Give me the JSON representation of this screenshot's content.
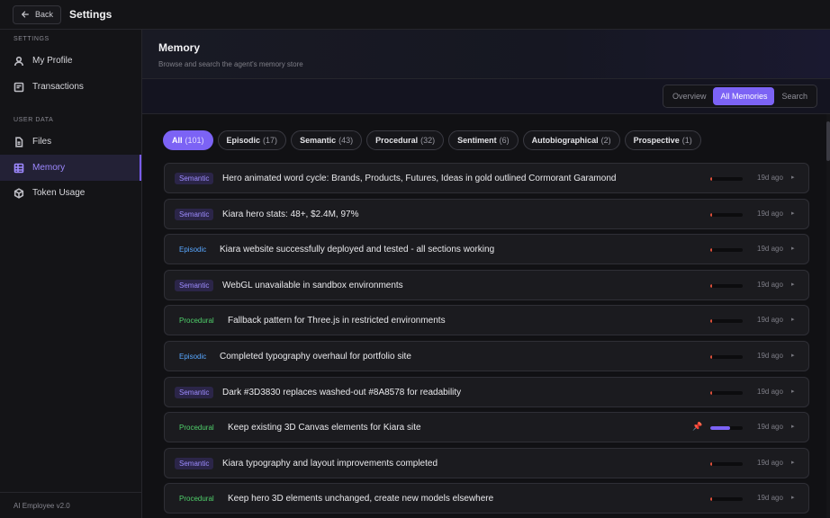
{
  "topbar": {
    "back_label": "Back",
    "title": "Settings"
  },
  "sidebar": {
    "section_settings": "SETTINGS",
    "section_user_data": "USER DATA",
    "items": [
      {
        "label": "My Profile",
        "icon": "user-icon"
      },
      {
        "label": "Transactions",
        "icon": "receipt-icon"
      },
      {
        "label": "Files",
        "icon": "file-icon"
      },
      {
        "label": "Memory",
        "icon": "memory-icon",
        "active": true
      },
      {
        "label": "Token Usage",
        "icon": "cube-icon"
      }
    ],
    "footer": "AI Employee v2.0"
  },
  "header": {
    "title": "Memory",
    "subtitle": "Browse and search the agent's memory store"
  },
  "tabs": [
    {
      "label": "Overview"
    },
    {
      "label": "All Memories",
      "active": true
    },
    {
      "label": "Search"
    }
  ],
  "filters": [
    {
      "label": "All",
      "count": "(101)",
      "active": true
    },
    {
      "label": "Episodic",
      "count": "(17)"
    },
    {
      "label": "Semantic",
      "count": "(43)"
    },
    {
      "label": "Procedural",
      "count": "(32)"
    },
    {
      "label": "Sentiment",
      "count": "(6)"
    },
    {
      "label": "Autobiographical",
      "count": "(2)"
    },
    {
      "label": "Prospective",
      "count": "(1)"
    }
  ],
  "memories": [
    {
      "type": "Semantic",
      "text": "Hero animated word cycle: Brands, Products, Futures, Ideas in gold outlined Cormorant Garamond",
      "age": "19d ago",
      "importance": 0.05,
      "pinned": false
    },
    {
      "type": "Semantic",
      "text": "Kiara hero stats: 48+, $2.4M, 97%",
      "age": "19d ago",
      "importance": 0.05,
      "pinned": false
    },
    {
      "type": "Episodic",
      "text": "Kiara website successfully deployed and tested - all sections working",
      "age": "19d ago",
      "importance": 0.05,
      "pinned": false
    },
    {
      "type": "Semantic",
      "text": "WebGL unavailable in sandbox environments",
      "age": "19d ago",
      "importance": 0.05,
      "pinned": false
    },
    {
      "type": "Procedural",
      "text": "Fallback pattern for Three.js in restricted environments",
      "age": "19d ago",
      "importance": 0.05,
      "pinned": false
    },
    {
      "type": "Episodic",
      "text": "Completed typography overhaul for portfolio site",
      "age": "19d ago",
      "importance": 0.05,
      "pinned": false
    },
    {
      "type": "Semantic",
      "text": "Dark #3D3830 replaces washed-out #8A8578 for readability",
      "age": "19d ago",
      "importance": 0.05,
      "pinned": false
    },
    {
      "type": "Procedural",
      "text": "Keep existing 3D Canvas elements for Kiara site",
      "age": "19d ago",
      "importance": 0.6,
      "pinned": true
    },
    {
      "type": "Semantic",
      "text": "Kiara typography and layout improvements completed",
      "age": "19d ago",
      "importance": 0.05,
      "pinned": false
    },
    {
      "type": "Procedural",
      "text": "Keep hero 3D elements unchanged, create new models elsewhere",
      "age": "19d ago",
      "importance": 0.05,
      "pinned": false
    }
  ],
  "colors": {
    "accent": "#7c63f5",
    "semantic": "#9d8cff",
    "episodic": "#58a7ff",
    "procedural": "#4fcf6a",
    "low_importance": "#e0503a",
    "pin": "#ff4d6d"
  }
}
